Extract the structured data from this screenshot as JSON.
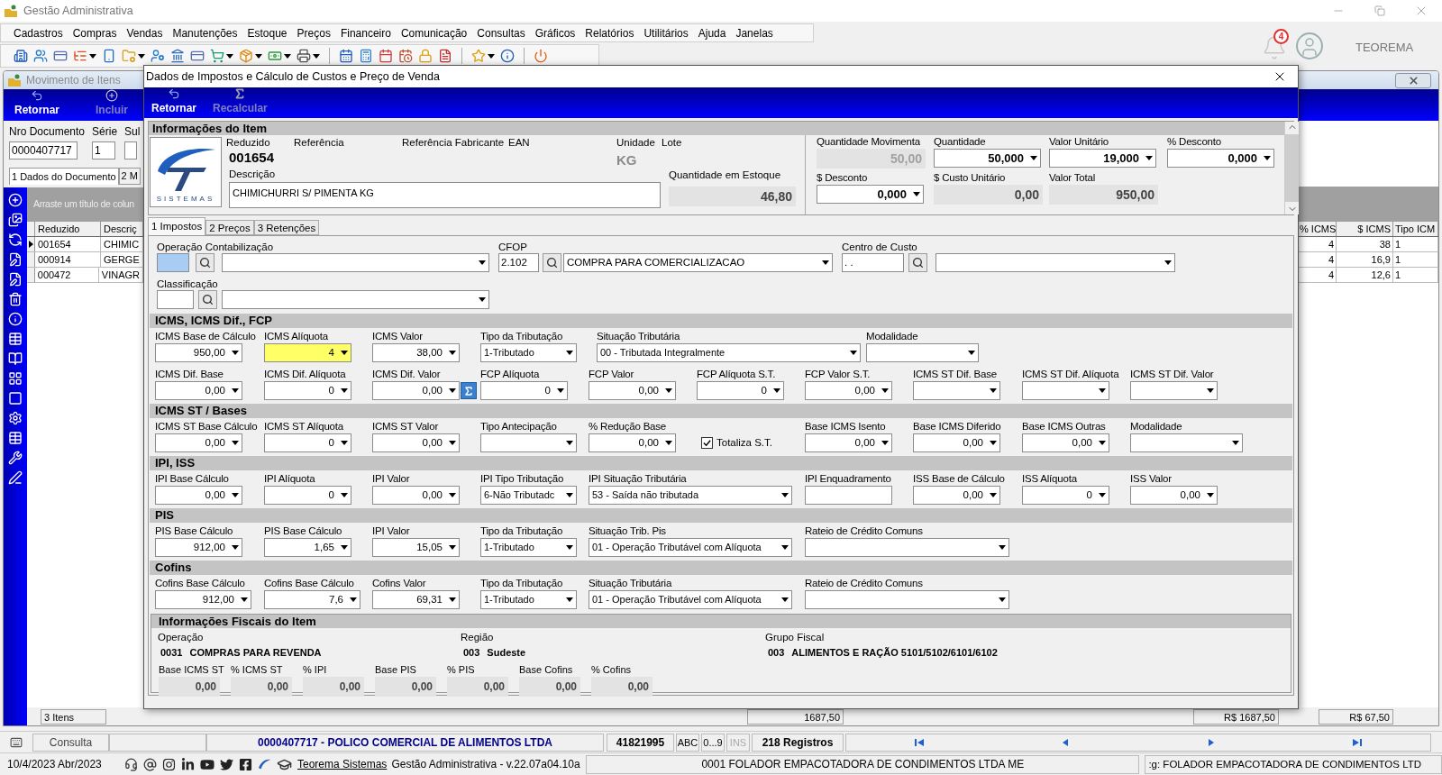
{
  "app_title": "Gestão Administrativa",
  "menu": [
    "Cadastros",
    "Compras",
    "Vendas",
    "Manutenções",
    "Estoque",
    "Preços",
    "Financeiro",
    "Comunicação",
    "Consultas",
    "Gráficos",
    "Relatórios",
    "Utilitários",
    "Ajuda",
    "Janelas"
  ],
  "notifications": {
    "count": "4"
  },
  "user": "TEOREMA",
  "background_window": {
    "title": "Movimento de Itens",
    "toolbar": [
      {
        "label": "Retornar",
        "disabled": false
      },
      {
        "label": "Incluir",
        "disabled": true
      }
    ],
    "fields": [
      {
        "label": "Nro Documento",
        "value": "0000407717"
      },
      {
        "label": "Série",
        "value": "1"
      },
      {
        "label": "Sul"
      }
    ],
    "tabs": [
      {
        "label": "1 Dados do Documento",
        "selected": true
      },
      {
        "label": "2 M",
        "selected": false
      }
    ],
    "group_hint": "Arraste um título de colun",
    "columns": [
      "Reduzido",
      "Descriç",
      "% ICMS",
      "$ ICMS",
      "Tipo ICM"
    ],
    "rows": [
      {
        "selected": true,
        "cells": [
          "001654",
          "CHIMIC",
          "4",
          "38",
          "1"
        ]
      },
      {
        "selected": false,
        "cells": [
          "000914",
          "GERGE",
          "4",
          "16,9",
          "1"
        ]
      },
      {
        "selected": false,
        "cells": [
          "000472",
          "VINAGR",
          "4",
          "12,6",
          "1"
        ]
      }
    ],
    "footer": [
      "3 Itens",
      "1687,50",
      "R$ 1687,50",
      "R$ 67,50"
    ]
  },
  "dialog": {
    "title": "Dados de Impostos e Cálculo de Custos e Preço de Venda",
    "toolbar": [
      {
        "label": "Retornar",
        "disabled": false
      },
      {
        "label": "Recalcular",
        "disabled": true
      }
    ],
    "item": {
      "heading": "Informações do Item",
      "logo_text": "SISTEMAS",
      "labels": [
        "Reduzido",
        "Referência",
        "Referência Fabricante",
        "EAN",
        "Unidade",
        "Lote"
      ],
      "code": "001654",
      "unit": "KG",
      "description_label": "Descrição",
      "description": "CHIMICHURRI S/ PIMENTA KG",
      "stock_label": "Quantidade em Estoque",
      "stock": "46,80",
      "values": [
        {
          "label": "Quantidade Movimenta",
          "value": "50,00",
          "kind": "readonly",
          "disabled": true
        },
        {
          "label": "Quantidade",
          "value": "50,000",
          "kind": "number",
          "disabled": false
        },
        {
          "label": "Valor Unitário",
          "value": "19,000",
          "kind": "number",
          "disabled": false
        },
        {
          "label": "% Desconto",
          "value": "0,000",
          "kind": "number",
          "disabled": false
        },
        {
          "label": "$ Desconto",
          "value": "0,000",
          "kind": "number",
          "disabled": false
        },
        {
          "label": "$ Custo Unitário",
          "value": "0,00",
          "kind": "readonly",
          "disabled": false
        },
        {
          "label": "Valor Total",
          "value": "950,00",
          "kind": "readonly",
          "disabled": false
        }
      ]
    },
    "tabs": [
      {
        "label": "1 Impostos",
        "selected": true
      },
      {
        "label": "2 Preços",
        "selected": false
      },
      {
        "label": "3 Retenções",
        "selected": false
      }
    ],
    "lookups": [
      {
        "label": "Operação Contabilização",
        "highlighted": true
      },
      {
        "label": "CFOP",
        "code": "2.102",
        "highlighted": false,
        "description": "COMPRA PARA COMERCIALIZACAO"
      },
      {
        "label": "Centro de Custo",
        "code": ". .",
        "highlighted": false
      },
      {
        "label": "Classificação",
        "highlighted": false
      }
    ],
    "sections": [
      {
        "title": "ICMS, ICMS Dif., FCP",
        "rows": [
          [
            {
              "label": "ICMS Base de Cálculo",
              "value": "950,00",
              "kind": "number",
              "focused": false
            },
            {
              "label": "ICMS Alíquota",
              "value": "4",
              "kind": "number",
              "focused": true
            },
            {
              "label": "ICMS Valor",
              "value": "38,00",
              "kind": "number",
              "focused": false
            },
            {
              "label": "Tipo da Tributação",
              "value": "1-Tributado",
              "kind": "select",
              "focused": false
            },
            {
              "label": "Situação Tributária",
              "value": "00 - Tributada Integralmente",
              "kind": "select",
              "focused": false
            },
            {
              "label": "Modalidade",
              "kind": "select",
              "focused": false
            }
          ],
          [
            {
              "label": "ICMS Dif. Base",
              "value": "0,00",
              "kind": "number",
              "focused": false
            },
            {
              "label": "ICMS Dif. Alíquota",
              "value": "0",
              "kind": "number",
              "focused": false
            },
            {
              "label": "ICMS Dif. Valor",
              "value": "0,00",
              "kind": "number_calc",
              "focused": false
            },
            {
              "label": "FCP Alíquota",
              "value": "0",
              "kind": "number",
              "focused": false
            },
            {
              "label": "FCP Valor",
              "value": "0,00",
              "kind": "number",
              "focused": false
            },
            {
              "label": "FCP Alíquota S.T.",
              "value": "0",
              "kind": "number",
              "focused": false
            },
            {
              "label": "FCP Valor S.T.",
              "value": "0,00",
              "kind": "number",
              "focused": false
            },
            {
              "label": "ICMS ST Dif. Base",
              "kind": "number",
              "focused": false
            },
            {
              "label": "ICMS ST Dif. Alíquota",
              "kind": "number",
              "focused": false
            },
            {
              "label": "ICMS ST Dif. Valor",
              "kind": "number",
              "focused": false
            }
          ]
        ]
      },
      {
        "title": "ICMS ST / Bases",
        "rows": [
          [
            {
              "label": "ICMS ST Base Cálculo",
              "value": "0,00",
              "kind": "number",
              "focused": false
            },
            {
              "label": "ICMS ST Alíquota",
              "value": "0",
              "kind": "number",
              "focused": false
            },
            {
              "label": "ICMS ST Valor",
              "value": "0,00",
              "kind": "number",
              "focused": false
            },
            {
              "label": "Tipo Antecipação",
              "kind": "select",
              "focused": false
            },
            {
              "label": "% Redução Base",
              "value": "0,00",
              "kind": "number",
              "focused": false
            },
            {
              "label": "Totaliza S.T.",
              "kind": "check",
              "checked": true
            },
            {
              "label": "Base ICMS Isento",
              "value": "0,00",
              "kind": "number",
              "focused": false
            },
            {
              "label": "Base ICMS Diferido",
              "value": "0,00",
              "kind": "number",
              "focused": false
            },
            {
              "label": "Base ICMS Outras",
              "value": "0,00",
              "kind": "number",
              "focused": false
            },
            {
              "label": "Modalidade",
              "kind": "select",
              "focused": false
            }
          ]
        ]
      },
      {
        "title": "IPI, ISS",
        "rows": [
          [
            {
              "label": "IPI Base Cálculo",
              "value": "0,00",
              "kind": "number",
              "focused": false
            },
            {
              "label": "IPI Alíquota",
              "value": "0",
              "kind": "number",
              "focused": false
            },
            {
              "label": "IPI Valor",
              "value": "0,00",
              "kind": "number",
              "focused": false
            },
            {
              "label": "IPI Tipo Tributação",
              "value": "6-Não Tributadc",
              "kind": "select",
              "focused": false
            },
            {
              "label": "IPI Situação Tributária",
              "value": "53 - Saída não tributada",
              "kind": "select",
              "focused": false
            },
            {
              "label": "IPI Enquadramento",
              "kind": "text",
              "focused": false
            },
            {
              "label": "ISS Base de Cálculo",
              "value": "0,00",
              "kind": "number",
              "focused": false
            },
            {
              "label": "ISS Alíquota",
              "value": "0",
              "kind": "number",
              "focused": false
            },
            {
              "label": "ISS Valor",
              "value": "0,00",
              "kind": "number",
              "focused": false
            }
          ]
        ]
      },
      {
        "title": "PIS",
        "rows": [
          [
            {
              "label": "PIS Base Cálculo",
              "value": "912,00",
              "kind": "number",
              "focused": false
            },
            {
              "label": "PIS Base Cálculo",
              "value": "1,65",
              "kind": "number",
              "focused": false
            },
            {
              "label": "IPI Valor",
              "value": "15,05",
              "kind": "number",
              "focused": false
            },
            {
              "label": "Tipo da Tributação",
              "value": "1-Tributado",
              "kind": "select",
              "focused": false
            },
            {
              "label": "Situação Trib. Pis",
              "value": "01 - Operação Tributável com Alíquota",
              "kind": "select",
              "focused": false
            },
            {
              "label": "Rateio de Crédito Comuns",
              "kind": "select",
              "focused": false
            }
          ]
        ]
      },
      {
        "title": "Cofins",
        "rows": [
          [
            {
              "label": "Cofins Base Cálculo",
              "value": "912,00",
              "kind": "number",
              "focused": false
            },
            {
              "label": "Cofins Base Cálculo",
              "value": "7,6",
              "kind": "number",
              "focused": false
            },
            {
              "label": "Cofins Valor",
              "value": "69,31",
              "kind": "number",
              "focused": false
            },
            {
              "label": "Tipo da Tributação",
              "value": "1-Tributado",
              "kind": "select",
              "focused": false
            },
            {
              "label": "Situação Tributária",
              "value": "01 - Operação Tributável com Alíquota",
              "kind": "select",
              "focused": false
            },
            {
              "label": "Rateio de Crédito Comuns",
              "kind": "select",
              "focused": false
            }
          ]
        ]
      }
    ],
    "fiscal": {
      "heading": "Informações Fiscais do Item",
      "groups": [
        {
          "label": "Operação",
          "code": "0031",
          "name": "COMPRAS PARA REVENDA"
        },
        {
          "label": "Região",
          "code": "003",
          "name": "Sudeste"
        },
        {
          "label": "Grupo Fiscal",
          "code": "003",
          "name": "ALIMENTOS E RAÇÃO 5101/5102/6101/6102"
        }
      ],
      "totals": [
        {
          "label": "Base ICMS ST",
          "value": "0,00"
        },
        {
          "label": "% ICMS ST",
          "value": "0,00"
        },
        {
          "label": "% IPI",
          "value": "0,00"
        },
        {
          "label": "Base PIS",
          "value": "0,00"
        },
        {
          "label": "% PIS",
          "value": "0,00"
        },
        {
          "label": "Base Cofins",
          "value": "0,00"
        },
        {
          "label": "% Cofins",
          "value": "0,00"
        }
      ]
    }
  },
  "status": {
    "mode": "Consulta",
    "record": "0000407717 - POLICO COMERCIAL DE ALIMENTOS LTDA",
    "code": "41821995",
    "flags": [
      {
        "label": "ABC",
        "disabled": false
      },
      {
        "label": "0...9",
        "disabled": false
      },
      {
        "label": "INS",
        "disabled": true
      }
    ],
    "records": "218 Registros"
  },
  "footer": {
    "date": "10/4/2023 Abr/2023",
    "link": "Teorema Sistemas",
    "version": "Gestão Administrativa - v.22.07a04.10a",
    "company": "0001 FOLADOR EMPACOTADORA DE CONDIMENTOS LTDA ME",
    "company_cut": ":g: FOLADOR EMPACOTADORA DE CONDIMENTOS LTD"
  }
}
